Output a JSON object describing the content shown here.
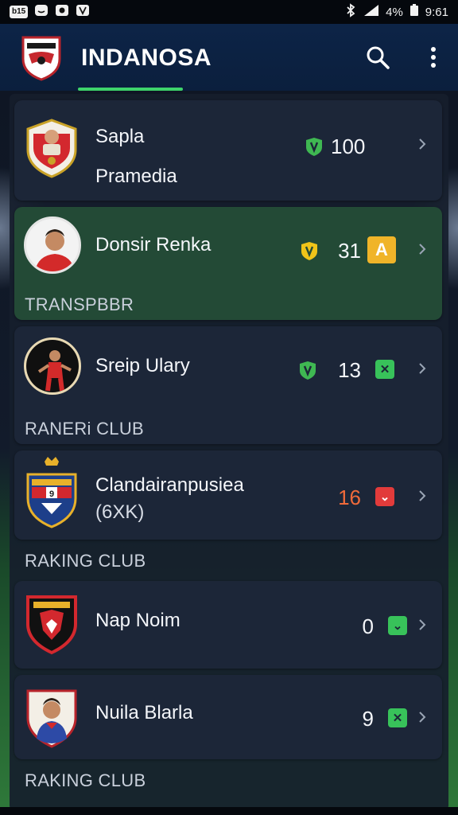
{
  "status_bar": {
    "left_chip_1": "b15",
    "battery_text": "4%",
    "time": "9:61"
  },
  "app_bar": {
    "title": "INDANOSA"
  },
  "items": [
    {
      "name_line1": "Sapla",
      "name_line2": "Pramedia",
      "value": "100",
      "value_color": "#f4f6fa",
      "icon_color": "#3fb852"
    },
    {
      "name_line1": "Donsir Renka",
      "value": "31",
      "badge_text": "A",
      "badge_color": "#f0b429",
      "icon_color": "#f0c419",
      "section_label": "TRANSPBBR"
    },
    {
      "name_line1": "Sreip Ulary",
      "value": "13",
      "icon_color": "#3fb852",
      "badge_color": "#38c25a",
      "section_label": "RANERi CLUB"
    },
    {
      "name_line1": "Clandairanpusiea",
      "name_line2": "(6XK)",
      "value": "16",
      "value_color": "#f06a3a",
      "badge_color": "#e23b3b",
      "section_label": "RAKING CLUB"
    },
    {
      "name_line1": "Nap Noim",
      "value": "0",
      "badge_color": "#38c25a"
    },
    {
      "name_line1": "Nuila Blarla",
      "value": "9",
      "badge_color": "#38c25a",
      "section_label": "RAKING CLUB"
    }
  ],
  "icons": {
    "search": "search-icon",
    "menu": "more-vert-icon",
    "chevron": "chevron-right-icon",
    "shield": "shield-icon"
  },
  "colors": {
    "accent": "#3ed46b",
    "app_bar": "#0d2447",
    "card": "#1c2638",
    "card_active": "#234a36"
  }
}
